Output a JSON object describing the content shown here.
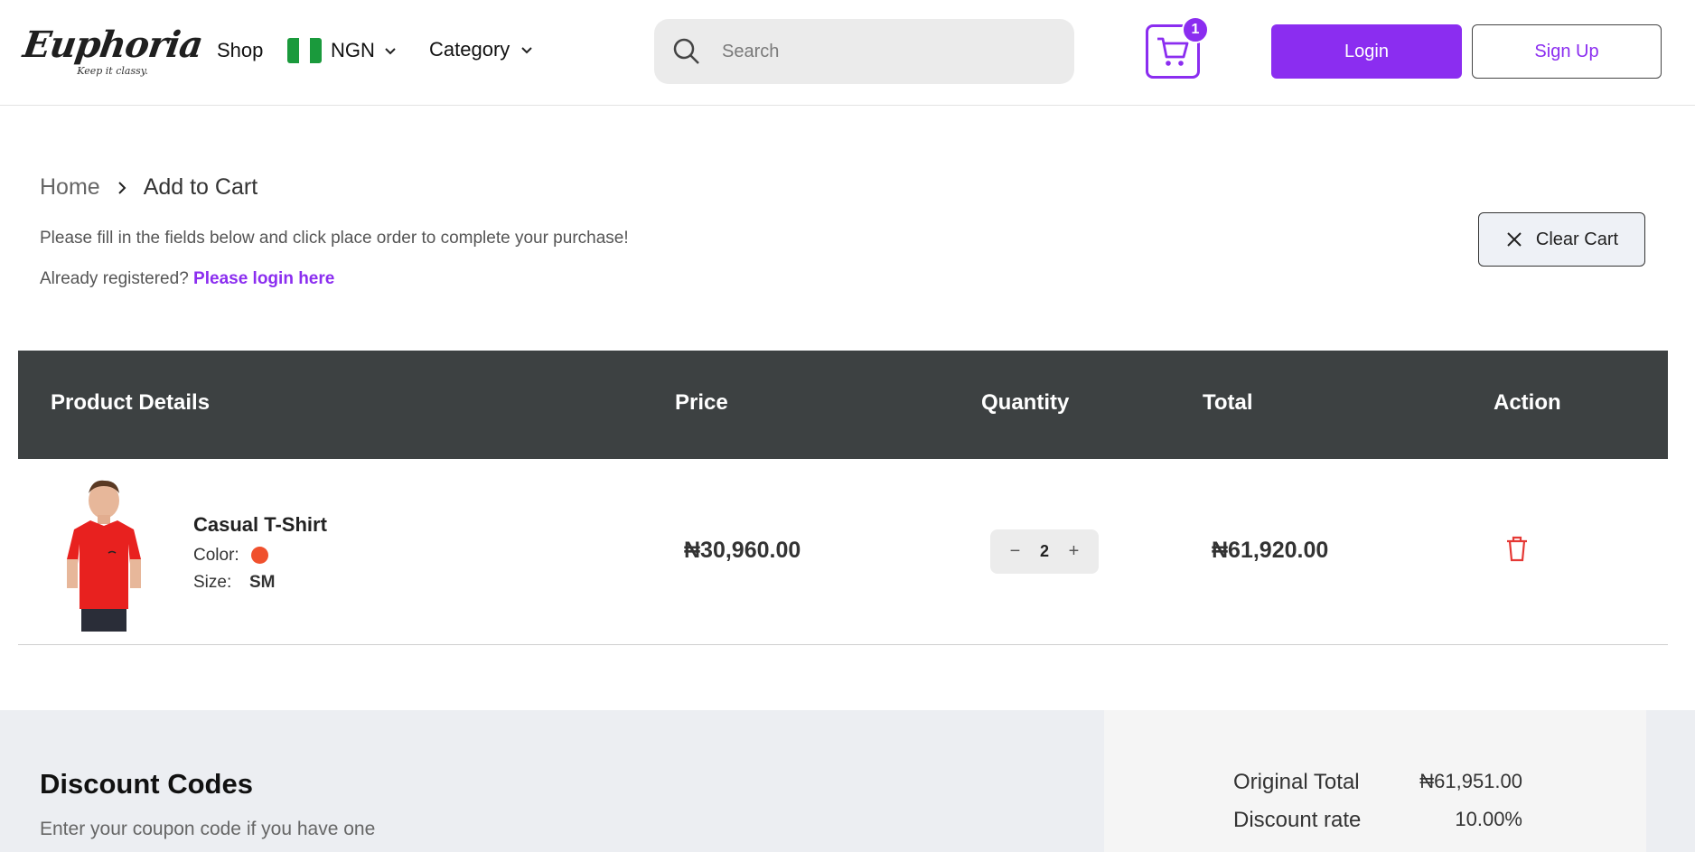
{
  "header": {
    "logo_text": "Euphoria",
    "logo_tagline": "Keep it classy.",
    "nav_shop": "Shop",
    "currency": "NGN",
    "nav_category": "Category",
    "search_placeholder": "Search",
    "cart_count": "1",
    "login_label": "Login",
    "signup_label": "Sign Up",
    "flag_colors": [
      "#1a9a3c",
      "#ffffff",
      "#1a9a3c"
    ]
  },
  "breadcrumb": {
    "home": "Home",
    "current": "Add to Cart"
  },
  "intro_text": "Please fill in the fields below and click place order to complete your purchase!",
  "already_text": "Already registered?",
  "login_link": "Please login here",
  "clear_cart_label": "Clear Cart",
  "table": {
    "headers": [
      "Product Details",
      "Price",
      "Quantity",
      "Total",
      "Action"
    ],
    "rows": [
      {
        "name": "Casual T-Shirt",
        "color_label": "Color:",
        "color_value": "#f0502d",
        "size_label": "Size:",
        "size_value": "SM",
        "price": "₦30,960.00",
        "quantity": "2",
        "total": "₦61,920.00",
        "action_icon": "trash-icon"
      }
    ]
  },
  "discount": {
    "title": "Discount Codes",
    "subtitle": "Enter your coupon code if you have one"
  },
  "summary": {
    "original_total_label": "Original Total",
    "original_total_value": "₦61,951.00",
    "discount_rate_label": "Discount rate",
    "discount_rate_value": "10.00%"
  },
  "colors": {
    "accent": "#8b2df0",
    "table_header_bg": "#3d4142",
    "trash": "#e53935"
  }
}
